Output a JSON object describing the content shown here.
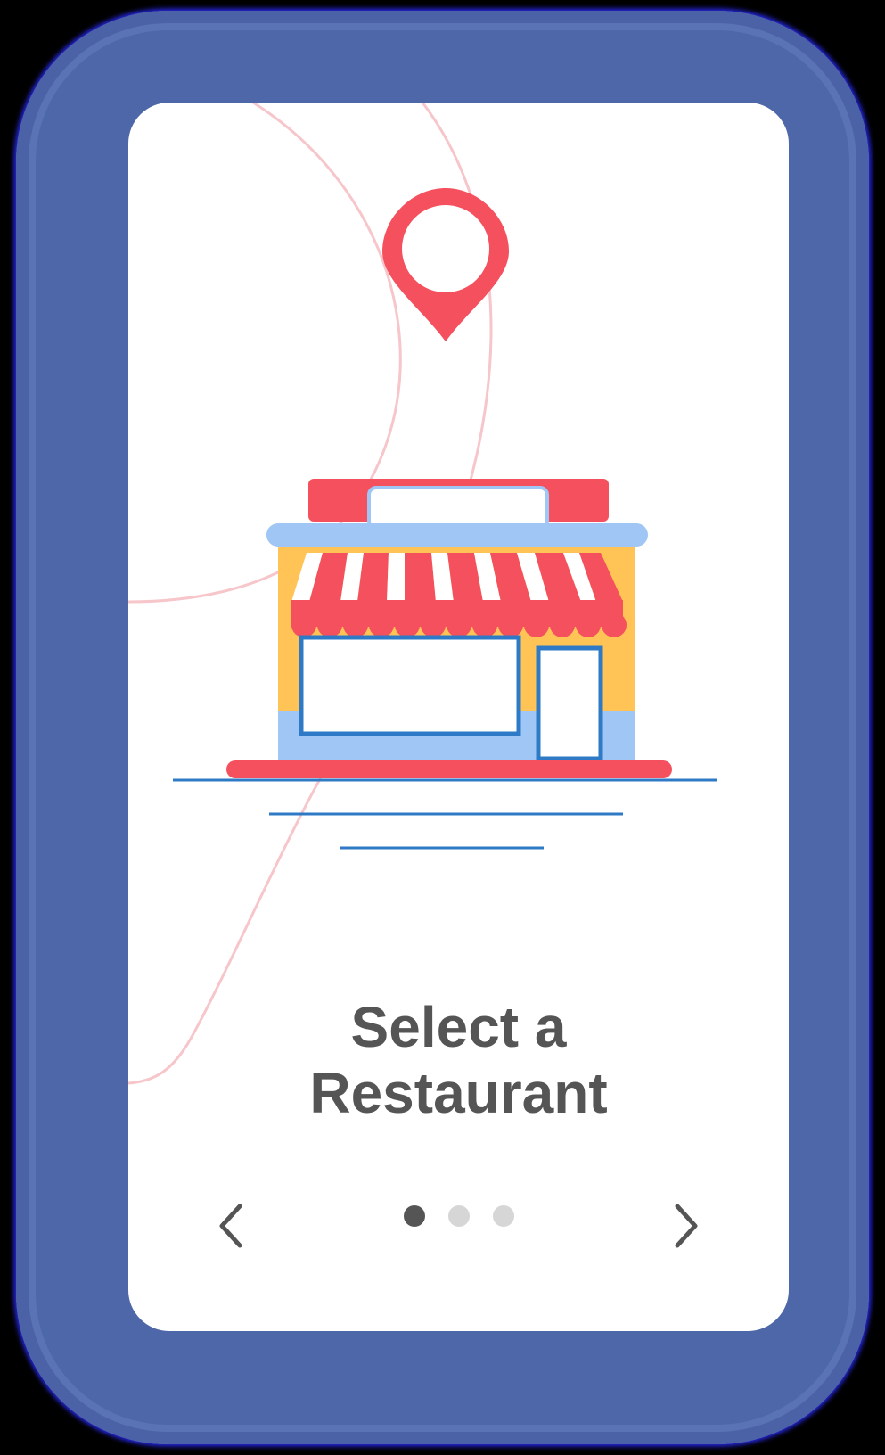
{
  "onboarding": {
    "title_line1": "Select a",
    "title_line2": "Restaurant",
    "page_current": 1,
    "page_total": 3
  },
  "illustration": {
    "pin_icon": "location-pin-icon",
    "store_icon": "storefront-icon"
  },
  "icons": {
    "prev": "chevron-left-icon",
    "next": "chevron-right-icon"
  },
  "colors": {
    "frame": "#4d67a8",
    "screen": "#ffffff",
    "accent_red": "#f4505e",
    "accent_blue": "#2f7ac6",
    "store_yellow": "#ffc455",
    "store_light_blue": "#9fc6f5",
    "text": "#555555",
    "dot_inactive": "#d6d6d6"
  }
}
